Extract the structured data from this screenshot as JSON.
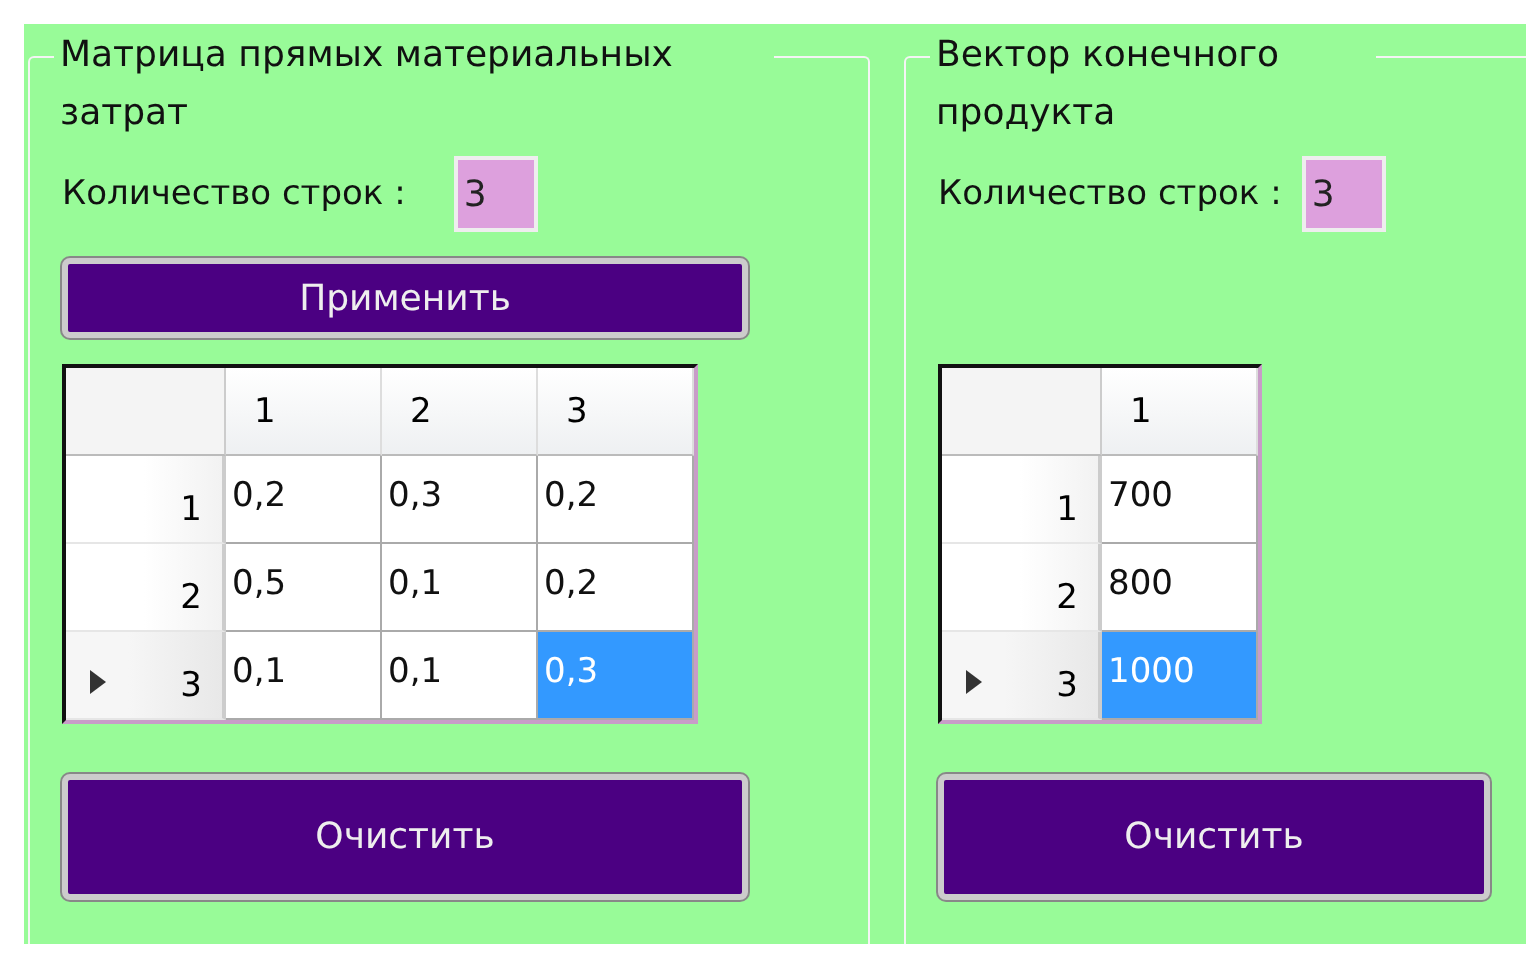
{
  "panels": [
    {
      "title": "Матрица прямых материальных затрат",
      "rows_label": "Количество строк :",
      "rows_value": "3",
      "apply_button": "Применить",
      "grid": {
        "columns": [
          "1",
          "2",
          "3"
        ],
        "rows": [
          {
            "header": "1",
            "current": false,
            "cells": [
              {
                "value": "0,2",
                "selected": false
              },
              {
                "value": "0,3",
                "selected": false
              },
              {
                "value": "0,2",
                "selected": false
              }
            ]
          },
          {
            "header": "2",
            "current": false,
            "cells": [
              {
                "value": "0,5",
                "selected": false
              },
              {
                "value": "0,1",
                "selected": false
              },
              {
                "value": "0,2",
                "selected": false
              }
            ]
          },
          {
            "header": "3",
            "current": true,
            "cells": [
              {
                "value": "0,1",
                "selected": false
              },
              {
                "value": "0,1",
                "selected": false
              },
              {
                "value": "0,3",
                "selected": true
              }
            ]
          }
        ]
      },
      "clear_button": "Очистить"
    },
    {
      "title": "Вектор конечного продукта",
      "rows_label": "Количество строк :",
      "rows_value": "3",
      "grid": {
        "columns": [
          "1"
        ],
        "rows": [
          {
            "header": "1",
            "current": false,
            "cells": [
              {
                "value": "700",
                "selected": false
              }
            ]
          },
          {
            "header": "2",
            "current": false,
            "cells": [
              {
                "value": "800",
                "selected": false
              }
            ]
          },
          {
            "header": "3",
            "current": true,
            "cells": [
              {
                "value": "1000",
                "selected": true
              }
            ]
          }
        ]
      },
      "clear_button": "Очистить"
    }
  ]
}
